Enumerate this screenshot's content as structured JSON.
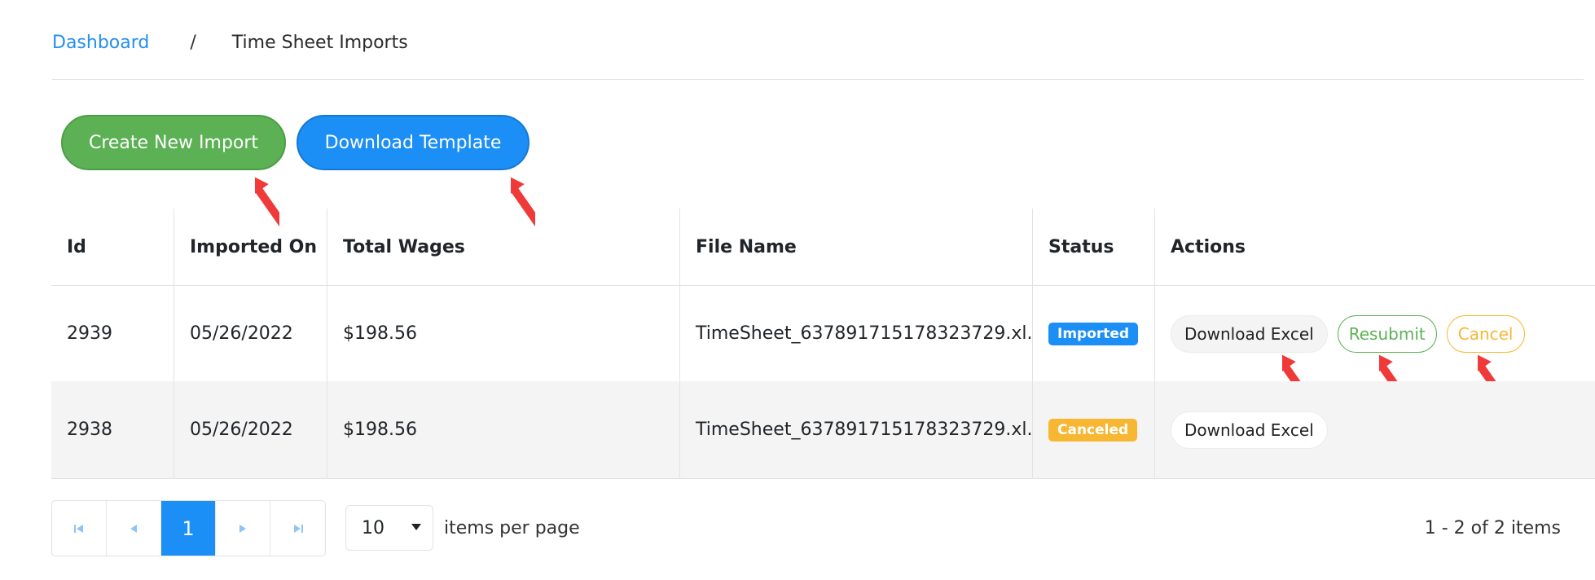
{
  "breadcrumb": {
    "home": "Dashboard",
    "separator": "/",
    "current": "Time Sheet Imports"
  },
  "toolbar": {
    "create_label": "Create New Import",
    "template_label": "Download Template"
  },
  "table": {
    "headers": [
      "Id",
      "Imported On",
      "Total Wages",
      "File Name",
      "Status",
      "Actions"
    ],
    "rows": [
      {
        "id": "2939",
        "imported_on": "05/26/2022",
        "total_wages": "$198.56",
        "file_name": "TimeSheet_637891715178323729.xl...",
        "status": "Imported",
        "actions": {
          "download": "Download Excel",
          "resubmit": "Resubmit",
          "cancel": "Cancel"
        }
      },
      {
        "id": "2938",
        "imported_on": "05/26/2022",
        "total_wages": "$198.56",
        "file_name": "TimeSheet_637891715178323729.xl...",
        "status": "Canceled",
        "actions": {
          "download": "Download Excel"
        }
      }
    ]
  },
  "pager": {
    "current_page": "1",
    "first_icon": "first-page-icon",
    "prev_icon": "prev-page-icon",
    "next_icon": "next-page-icon",
    "last_icon": "last-page-icon",
    "page_size": "10",
    "page_size_label": "items per page",
    "summary": "1 - 2 of 2 items"
  },
  "colors": {
    "primary": "#1b8ff5",
    "success": "#5cb155",
    "warning": "#f8b733",
    "annotation_arrow": "#f03a3a"
  }
}
